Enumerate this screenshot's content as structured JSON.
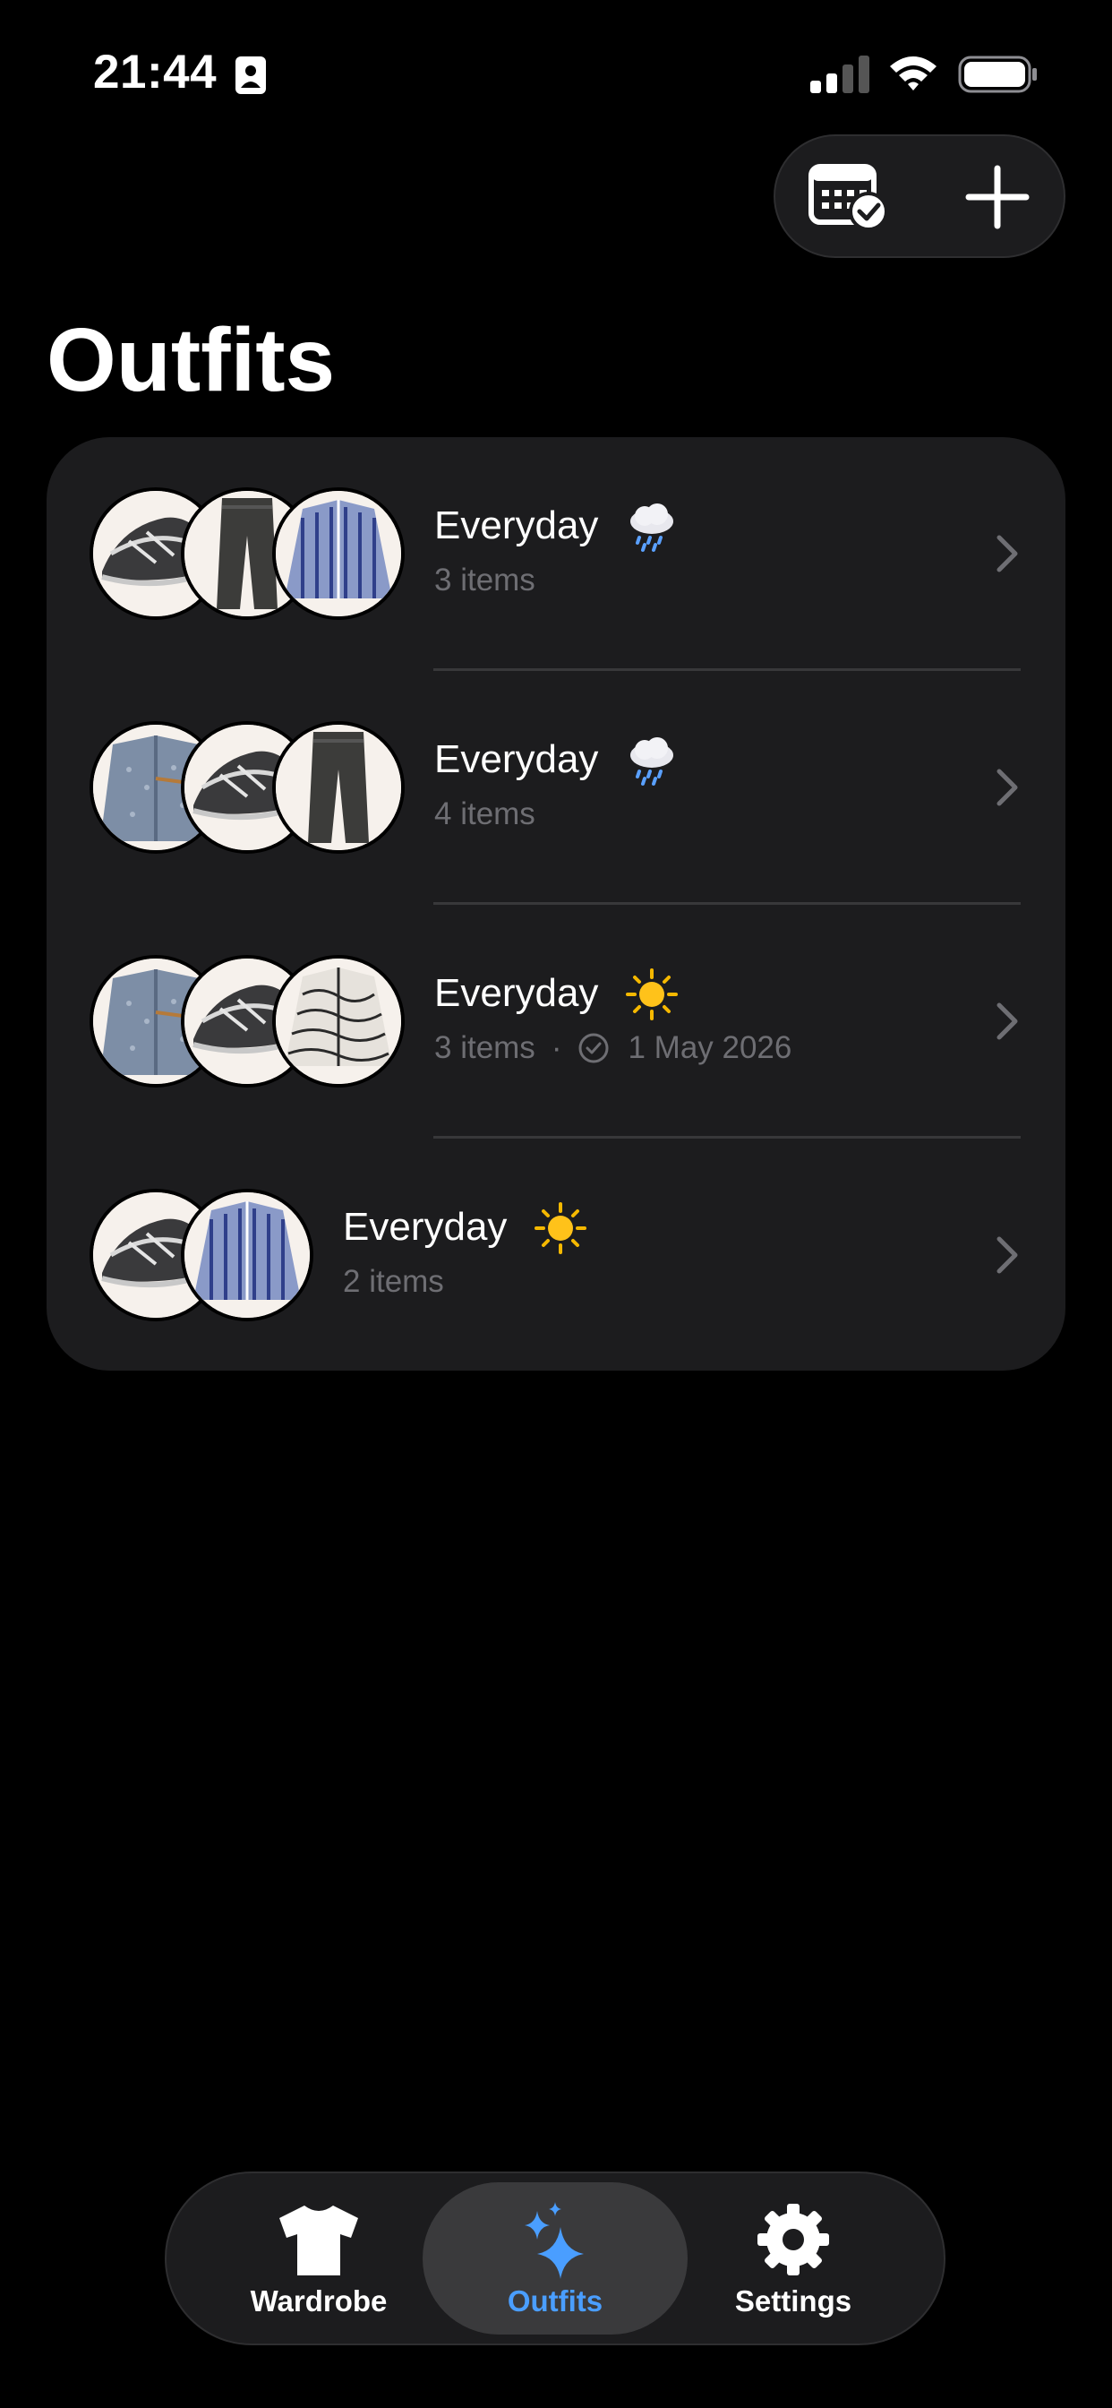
{
  "status_bar": {
    "time": "21:44"
  },
  "top_actions": {
    "calendar_icon": "calendar-check-icon",
    "add_icon": "plus-icon"
  },
  "page": {
    "title": "Outfits"
  },
  "outfits": [
    {
      "name": "Everyday",
      "weather": "rain-cloud",
      "count_text": "3 items",
      "worn_date": "",
      "thumbnails": [
        "sneakers",
        "dark-trousers",
        "striped-shirt"
      ]
    },
    {
      "name": "Everyday",
      "weather": "rain-cloud",
      "count_text": "4 items",
      "worn_date": "",
      "thumbnails": [
        "denim-jacket",
        "sneakers",
        "dark-trousers"
      ]
    },
    {
      "name": "Everyday",
      "weather": "sun",
      "count_text": "3 items",
      "separator": "·",
      "worn_date": "1 May 2026",
      "thumbnails": [
        "denim-jacket",
        "sneakers",
        "patterned-shirt"
      ]
    },
    {
      "name": "Everyday",
      "weather": "sun",
      "count_text": "2 items",
      "worn_date": "",
      "thumbnails": [
        "sneakers",
        "striped-shirt"
      ]
    }
  ],
  "tab_bar": {
    "tabs": [
      {
        "label": "Wardrobe",
        "icon": "tshirt-icon",
        "active": false
      },
      {
        "label": "Outfits",
        "icon": "sparkles-icon",
        "active": true
      },
      {
        "label": "Settings",
        "icon": "gear-icon",
        "active": false
      }
    ]
  },
  "colors": {
    "background": "#000000",
    "card": "#1c1c1e",
    "secondary_text": "#6e6e73",
    "accent": "#4a9eff",
    "sun": "#f5b800"
  }
}
